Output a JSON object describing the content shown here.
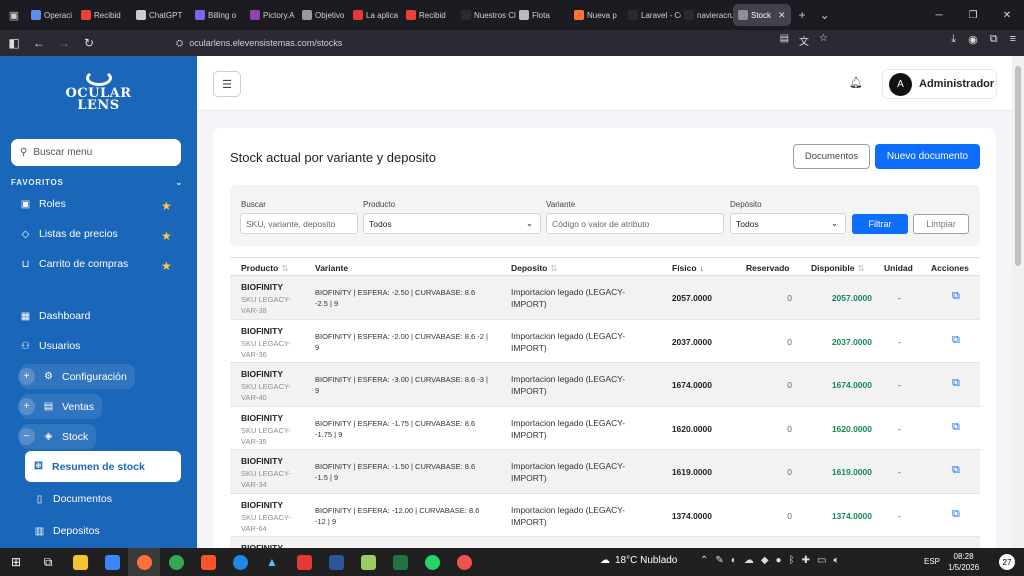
{
  "browser": {
    "tabs": [
      {
        "title": "Operaci",
        "color": "#5b8def"
      },
      {
        "title": "Recibid",
        "color": "#ea4335"
      },
      {
        "title": "ChatGPT",
        "color": "#cccccc"
      },
      {
        "title": "Billing o",
        "color": "#7b68ee"
      },
      {
        "title": "Pictory.A",
        "color": "#8e44ad"
      },
      {
        "title": "Objetivo",
        "color": "#9a9a9a"
      },
      {
        "title": "La aplica",
        "color": "#e53935"
      },
      {
        "title": "Recibid",
        "color": "#ea4335"
      },
      {
        "title": "Nuestros Cli",
        "color": "#2b2a33"
      },
      {
        "title": "Flota",
        "color": "#bbbbbb"
      },
      {
        "title": "Nueva p",
        "color": "#ff7139"
      },
      {
        "title": "Laravel - Cer",
        "color": "#2b2a33"
      },
      {
        "title": "navieracruza",
        "color": "#2b2a33"
      }
    ],
    "active_tab": "Stock",
    "url": "ocularlens.elevensistemas.com/stocks"
  },
  "sidebar": {
    "brand": [
      "OCULAR",
      "LENS"
    ],
    "search_placeholder": "Buscar menu",
    "favorites_title": "FAVORITOS",
    "favorites": [
      "Roles",
      "Listas de precios",
      "Carrito de compras"
    ],
    "items": [
      "Dashboard",
      "Usuarios"
    ],
    "groups": [
      "Configuración",
      "Ventas",
      "Stock"
    ],
    "active": "Resumen de stock",
    "sub_items": [
      "Documentos",
      "Depositos"
    ]
  },
  "header": {
    "user_initial": "A",
    "user_name": "Administrador"
  },
  "page": {
    "title": "Stock actual por variante y deposito",
    "btn_documents": "Documentos",
    "btn_new": "Nuevo documento",
    "filters": {
      "search_label": "Buscar",
      "search_placeholder": "SKU, variante, deposito",
      "product_label": "Producto",
      "product_value": "Todos",
      "variant_label": "Variante",
      "variant_placeholder": "Código o valor de atributo",
      "deposit_label": "Depósito",
      "deposit_value": "Todos",
      "btn_filter": "Filtrar",
      "btn_clear": "Limpiar"
    }
  },
  "table": {
    "columns": {
      "producto": "Producto",
      "variante": "Variante",
      "deposito": "Deposito",
      "fisico": "Físico",
      "reservado": "Reservado",
      "disponible": "Disponible",
      "unidad": "Unidad",
      "acciones": "Acciones"
    },
    "rows": [
      {
        "product": "BIOFINITY",
        "sku": "SKU LEGACY-VAR-38",
        "variant": "BIOFINITY | ESFERA: -2.50 | CURVABASE: 8.6 -2.5 | 9",
        "deposit": "Importacion legado (LEGACY-IMPORT)",
        "fisico": "2057.0000",
        "reservado": "0",
        "disponible": "2057.0000",
        "unidad": "-"
      },
      {
        "product": "BIOFINITY",
        "sku": "SKU LEGACY-VAR-36",
        "variant": "BIOFINITY | ESFERA: -2.00 | CURVABASE: 8.6 -2 | 9",
        "deposit": "Importacion legado (LEGACY-IMPORT)",
        "fisico": "2037.0000",
        "reservado": "0",
        "disponible": "2037.0000",
        "unidad": "-"
      },
      {
        "product": "BIOFINITY",
        "sku": "SKU LEGACY-VAR-40",
        "variant": "BIOFINITY | ESFERA: -3.00 | CURVABASE: 8.6 -3 | 9",
        "deposit": "Importacion legado (LEGACY-IMPORT)",
        "fisico": "1674.0000",
        "reservado": "0",
        "disponible": "1674.0000",
        "unidad": "-"
      },
      {
        "product": "BIOFINITY",
        "sku": "SKU LEGACY-VAR-35",
        "variant": "BIOFINITY | ESFERA: -1.75 | CURVABASE: 8.6 -1.75 | 9",
        "deposit": "Importacion legado (LEGACY-IMPORT)",
        "fisico": "1620.0000",
        "reservado": "0",
        "disponible": "1620.0000",
        "unidad": "-"
      },
      {
        "product": "BIOFINITY",
        "sku": "SKU LEGACY-VAR-34",
        "variant": "BIOFINITY | ESFERA: -1.50 | CURVABASE: 8.6 -1.5 | 9",
        "deposit": "Importacion legado (LEGACY-IMPORT)",
        "fisico": "1619.0000",
        "reservado": "0",
        "disponible": "1619.0000",
        "unidad": "-"
      },
      {
        "product": "BIOFINITY",
        "sku": "SKU LEGACY-VAR-64",
        "variant": "BIOFINITY | ESFERA: -12.00 | CURVABASE: 8.6 -12 | 9",
        "deposit": "Importacion legado (LEGACY-IMPORT)",
        "fisico": "1374.0000",
        "reservado": "0",
        "disponible": "1374.0000",
        "unidad": "-"
      },
      {
        "product": "BIOFINITY",
        "sku": "",
        "variant": "",
        "deposit": "Importacion legado (LEGACY-",
        "fisico": "",
        "reservado": "",
        "disponible": "",
        "unidad": ""
      }
    ]
  },
  "taskbar": {
    "weather": "18°C Nublado",
    "lang": "ESP",
    "time": "08:28",
    "date": "1/5/2026",
    "notifications": "27"
  }
}
